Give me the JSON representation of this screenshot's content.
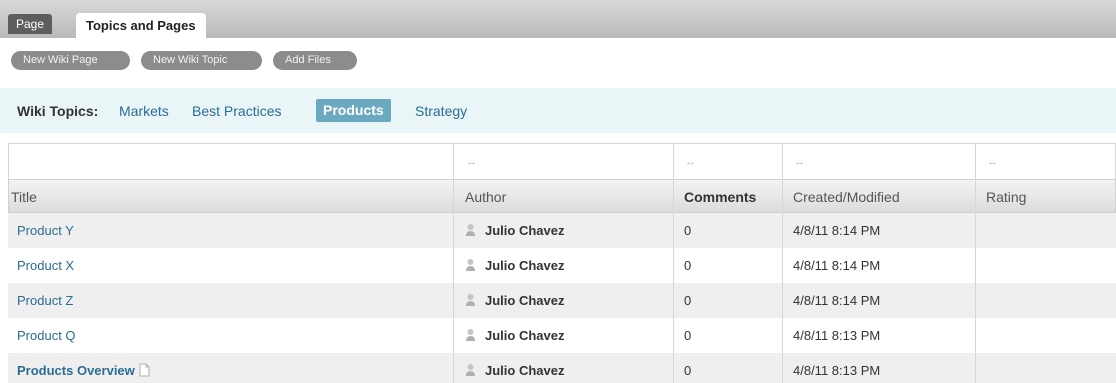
{
  "tabs": {
    "page": "Page",
    "topics_and_pages": "Topics and Pages"
  },
  "actions": {
    "new_wiki_page": "New Wiki Page",
    "new_wiki_topic": "New Wiki Topic",
    "add_files": "Add Files"
  },
  "topics": {
    "label": "Wiki Topics:",
    "items": [
      "Markets",
      "Best Practices",
      "Products",
      "Strategy"
    ],
    "active": "Products"
  },
  "table": {
    "resize_glyph": "↔",
    "columns": [
      "Title",
      "Author",
      "Comments",
      "Created/Modified",
      "Rating"
    ],
    "rows": [
      {
        "title": "Product Y",
        "author": "Julio Chavez",
        "comments": "0",
        "modified": "4/8/11 8:14 PM",
        "rating": ""
      },
      {
        "title": "Product X",
        "author": "Julio Chavez",
        "comments": "0",
        "modified": "4/8/11 8:14 PM",
        "rating": ""
      },
      {
        "title": "Product Z",
        "author": "Julio Chavez",
        "comments": "0",
        "modified": "4/8/11 8:14 PM",
        "rating": ""
      },
      {
        "title": "Product Q",
        "author": "Julio Chavez",
        "comments": "0",
        "modified": "4/8/11 8:13 PM",
        "rating": ""
      },
      {
        "title": "Products Overview",
        "author": "Julio Chavez",
        "comments": "0",
        "modified": "4/8/11 8:13 PM",
        "rating": ""
      }
    ]
  },
  "colors": {
    "link": "#2a6d93",
    "active_topic_bg": "#6aa9bf",
    "topics_bg": "#e9f5f7",
    "pill_bg": "#8c8c8c"
  },
  "icons": {
    "avatar": "user-avatar-icon",
    "page": "page-icon"
  }
}
